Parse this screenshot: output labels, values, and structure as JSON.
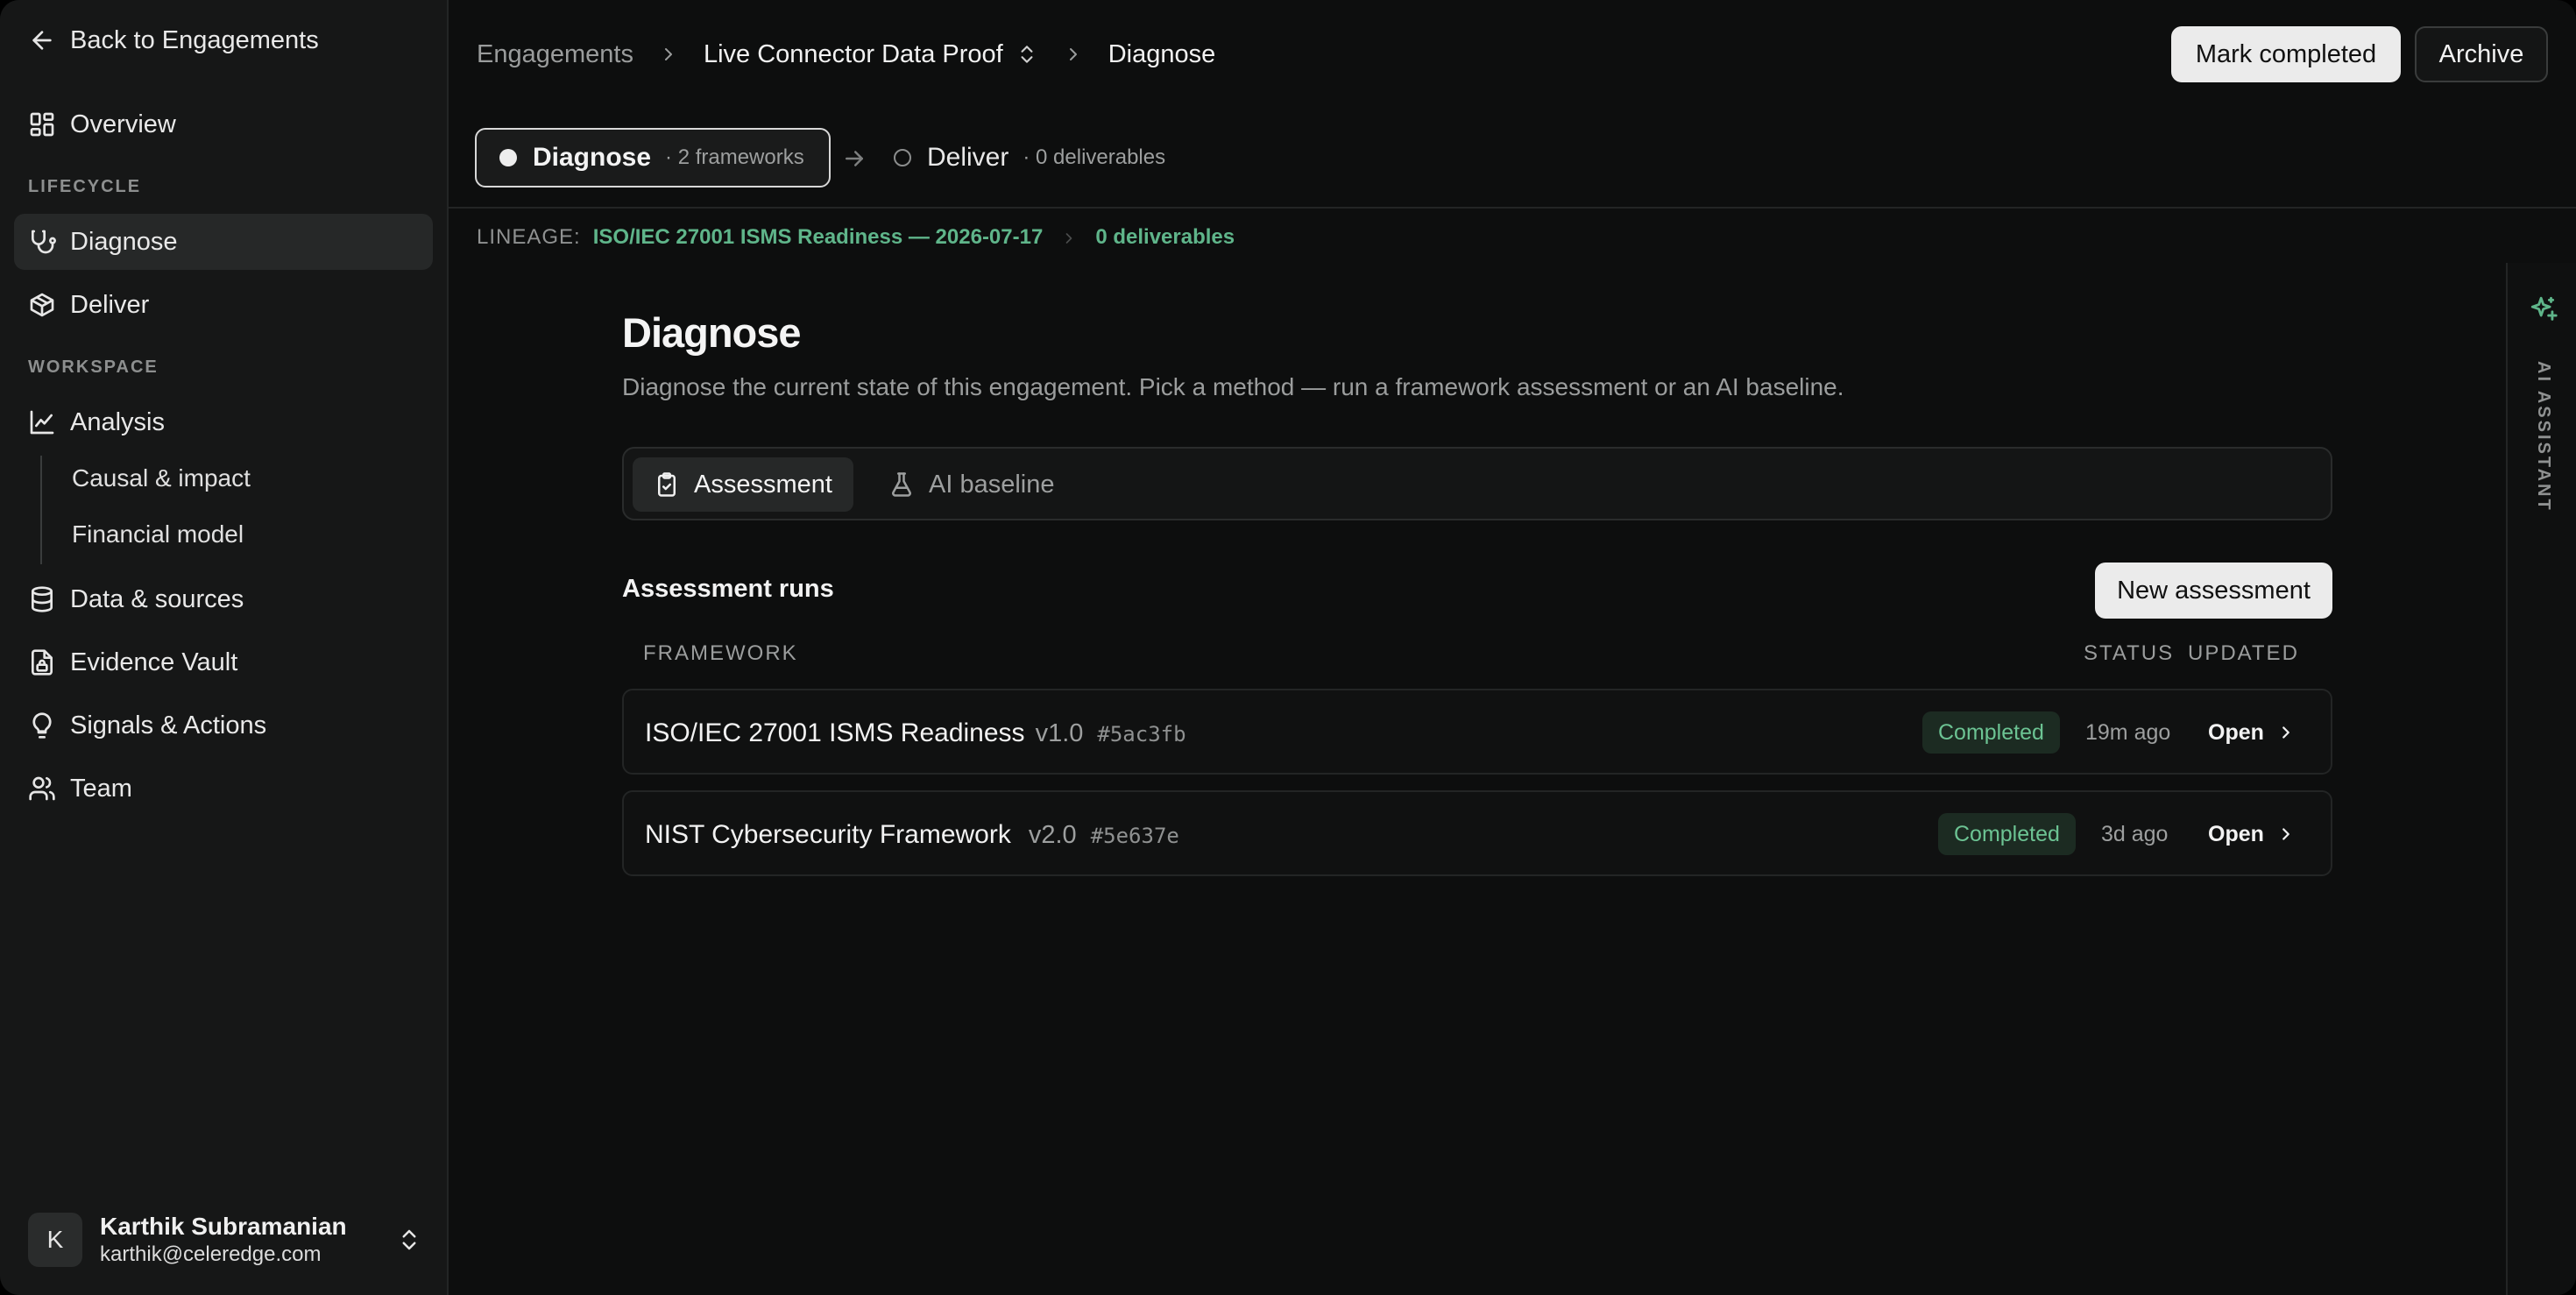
{
  "sidebar": {
    "back_label": "Back to Engagements",
    "overview_label": "Overview",
    "lifecycle_heading": "LIFECYCLE",
    "diagnose_label": "Diagnose",
    "deliver_label": "Deliver",
    "workspace_heading": "WORKSPACE",
    "analysis_label": "Analysis",
    "analysis_children": [
      "Causal & impact",
      "Financial model"
    ],
    "data_sources_label": "Data & sources",
    "evidence_vault_label": "Evidence Vault",
    "signals_actions_label": "Signals & Actions",
    "team_label": "Team",
    "user": {
      "initial": "K",
      "name": "Karthik Subramanian",
      "email": "karthik@celeredge.com"
    }
  },
  "header": {
    "breadcrumb": [
      "Engagements",
      "Live Connector Data Proof",
      "Diagnose"
    ],
    "mark_completed_label": "Mark completed",
    "archive_label": "Archive"
  },
  "stages": {
    "current": {
      "name": "Diagnose",
      "meta": "· 2 frameworks"
    },
    "next": {
      "name": "Deliver",
      "meta": "· 0 deliverables"
    }
  },
  "lineage": {
    "label": "LINEAGE:",
    "source": "ISO/IEC 27001 ISMS Readiness — 2026-07-17",
    "target": "0 deliverables"
  },
  "main": {
    "title": "Diagnose",
    "subtitle": "Diagnose the current state of this engagement. Pick a method — run a framework assessment or an AI baseline.",
    "tabs": [
      {
        "label": "Assessment",
        "active": true
      },
      {
        "label": "AI baseline",
        "active": false
      }
    ],
    "runs_title": "Assessment runs",
    "new_assessment_label": "New assessment",
    "columns": [
      "FRAMEWORK",
      "STATUS",
      "UPDATED"
    ],
    "runs": [
      {
        "name": "ISO/IEC 27001 ISMS Readiness",
        "version": "v1.0",
        "hash": "#5ac3fb",
        "status": "Completed",
        "updated": "19m ago",
        "action": "Open"
      },
      {
        "name": "NIST Cybersecurity Framework",
        "version": "v2.0",
        "hash": "#5e637e",
        "status": "Completed",
        "updated": "3d ago",
        "action": "Open"
      }
    ]
  },
  "assistant": {
    "label": "AI ASSISTANT"
  },
  "colors": {
    "accent_green": "#5fb58a",
    "badge_bg": "#1c2b22",
    "sidebar_bg": "#161717",
    "main_bg": "#0d0e0e"
  }
}
